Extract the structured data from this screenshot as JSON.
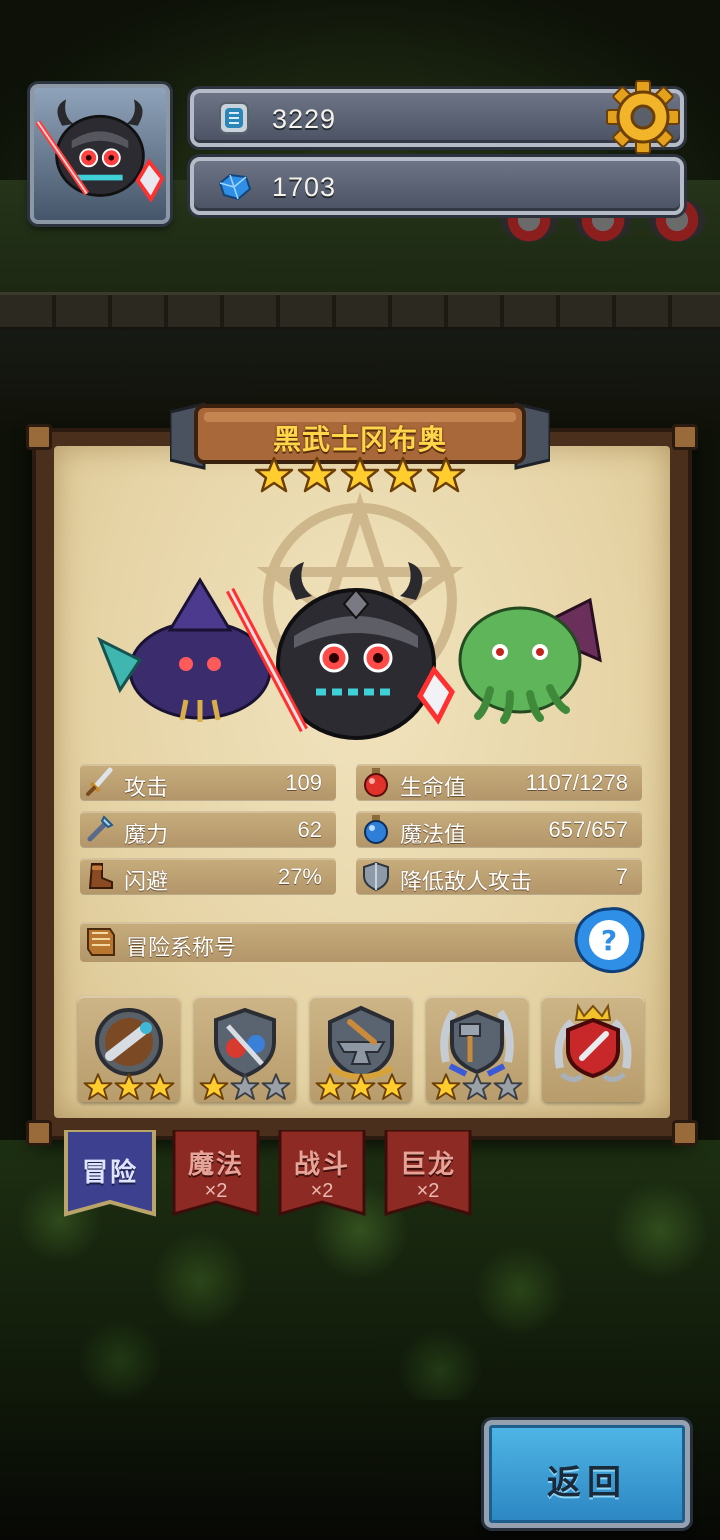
{
  "resources": {
    "gold": {
      "icon": "silver-coin-icon",
      "value": "3229"
    },
    "gems": {
      "icon": "blue-gem-icon",
      "value": "1703"
    }
  },
  "hero": {
    "name": "黑武士冈布奥",
    "stars": 5,
    "portrait_icon": "black-knight-helmet-icon"
  },
  "stats": {
    "attack": {
      "icon": "sword-icon",
      "label": "攻击",
      "value": "109"
    },
    "hp": {
      "icon": "red-potion-icon",
      "label": "生命值",
      "value": "1107/1278"
    },
    "magic": {
      "icon": "magic-wand-icon",
      "label": "魔力",
      "value": "62"
    },
    "mp": {
      "icon": "blue-potion-icon",
      "label": "魔法值",
      "value": "657/657"
    },
    "dodge": {
      "icon": "boot-icon",
      "label": "闪避",
      "value": "27%"
    },
    "reduce_enemy_attack": {
      "icon": "shield-icon",
      "label": "降低敌人攻击",
      "value": "7"
    }
  },
  "title_section": {
    "icon": "scroll-badge-icon",
    "label": "冒险系称号",
    "help_icon": "question-icon"
  },
  "badges": [
    {
      "icon": "telescope-badge-icon",
      "stars": 3
    },
    {
      "icon": "potion-shield-badge-icon",
      "stars": 1
    },
    {
      "icon": "anvil-badge-icon",
      "stars": 3
    },
    {
      "icon": "hammer-laurel-badge-icon",
      "stars": 1
    },
    {
      "icon": "crowned-crest-badge-icon",
      "stars": 0
    }
  ],
  "tabs": [
    {
      "label": "冒险",
      "mult": "",
      "active": true
    },
    {
      "label": "魔法",
      "mult": "×2",
      "active": false
    },
    {
      "label": "战斗",
      "mult": "×2",
      "active": false
    },
    {
      "label": "巨龙",
      "mult": "×2",
      "active": false
    }
  ],
  "back_button": {
    "label": "返回"
  },
  "colors": {
    "star_gold": "#ffce2e",
    "star_empty": "#9aa0a8",
    "tab_active": "#3d3f8f",
    "tab_inactive": "#8e2a24",
    "back_blue": "#3aa0d6"
  }
}
